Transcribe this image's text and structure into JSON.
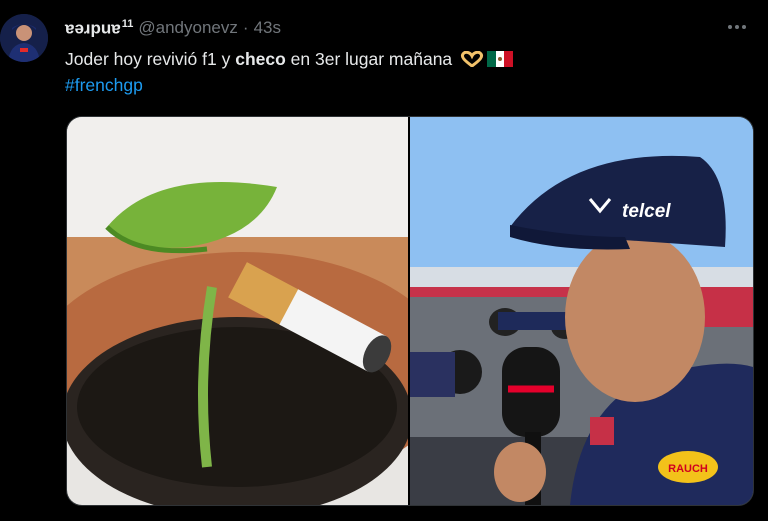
{
  "tweet": {
    "display_name": "ɐǝɹpuɐ",
    "badge": "11",
    "handle": "@andyonevz",
    "separator": "·",
    "time": "43s",
    "text_part1": "Joder hoy revivió f1 y ",
    "text_bold": "checo",
    "text_part2": " en 3er lugar mañana",
    "hashtag": "#frenchgp"
  },
  "icons": {
    "avatar": "avatar",
    "more": "more-icon",
    "heart": "heart-hands-emoji",
    "flag": "mexico-flag-emoji"
  },
  "media": {
    "right_cap_logo": "telcel",
    "right_sponsor_badge": "RAUCH"
  },
  "colors": {
    "background": "#000000",
    "text": "#e7e9ea",
    "secondary": "#71767b",
    "link": "#1d9bf0"
  }
}
